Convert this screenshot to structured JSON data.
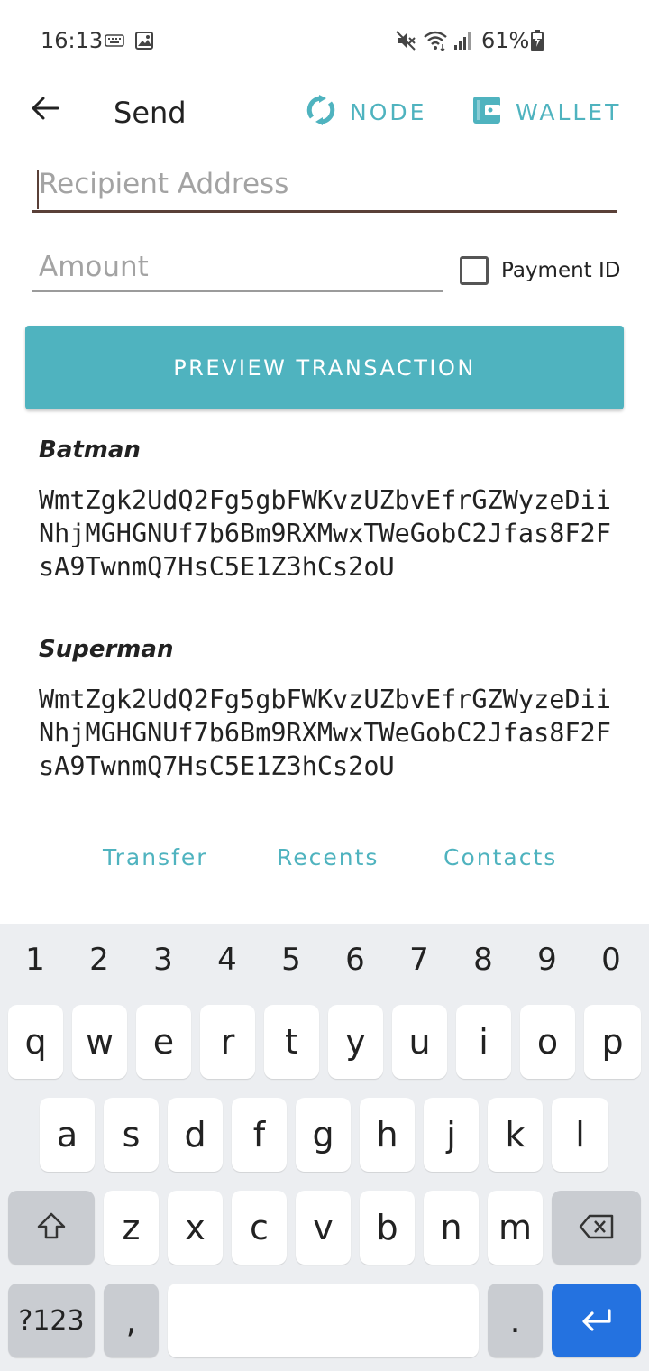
{
  "status_bar": {
    "time": "16:13",
    "battery": "61%"
  },
  "app_bar": {
    "title": "Send",
    "node_label": "NODE",
    "wallet_label": "WALLET"
  },
  "form": {
    "recipient_placeholder": "Recipient Address",
    "amount_placeholder": "Amount",
    "payment_id_label": "Payment ID",
    "payment_id_checked": false,
    "preview_button": "PREVIEW TRANSACTION"
  },
  "contacts": [
    {
      "name": "Batman",
      "address": "WmtZgk2UdQ2Fg5gbFWKvzUZbvEfrGZWyzeDiiNhjMGHGNUf7b6Bm9RXMwxTWeGobC2Jfas8F2FsA9TwnmQ7HsC5E1Z3hCs2oU"
    },
    {
      "name": "Superman",
      "address": "WmtZgk2UdQ2Fg5gbFWKvzUZbvEfrGZWyzeDiiNhjMGHGNUf7b6Bm9RXMwxTWeGobC2Jfas8F2FsA9TwnmQ7HsC5E1Z3hCs2oU"
    }
  ],
  "tabs": [
    "Transfer",
    "Recents",
    "Contacts"
  ],
  "keyboard": {
    "numbers": [
      "1",
      "2",
      "3",
      "4",
      "5",
      "6",
      "7",
      "8",
      "9",
      "0"
    ],
    "row1": [
      "q",
      "w",
      "e",
      "r",
      "t",
      "y",
      "u",
      "i",
      "o",
      "p"
    ],
    "row2": [
      "a",
      "s",
      "d",
      "f",
      "g",
      "h",
      "j",
      "k",
      "l"
    ],
    "row3": [
      "z",
      "x",
      "c",
      "v",
      "b",
      "n",
      "m"
    ],
    "symbols_key": "?123",
    "comma_key": ",",
    "period_key": "."
  },
  "colors": {
    "accent": "#4fb3bf",
    "enter_key": "#2472e0",
    "keyboard_bg": "#eceef1"
  },
  "icons": {
    "status": [
      "keyboard-icon",
      "image-icon",
      "mute-icon",
      "wifi-icon",
      "signal-icon",
      "battery-charging-icon"
    ],
    "app_bar": [
      "back-arrow-icon",
      "sync-icon",
      "wallet-icon"
    ],
    "keyboard": [
      "shift-icon",
      "backspace-icon",
      "enter-icon"
    ]
  }
}
